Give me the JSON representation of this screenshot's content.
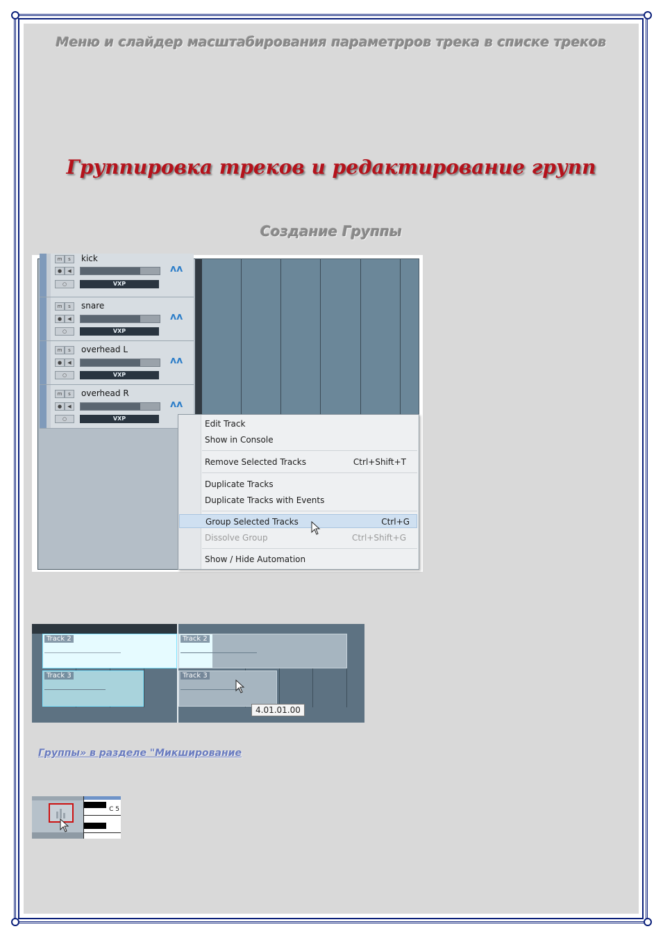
{
  "heading_top": "Меню и слайдер масштабирования параметрров трека в списке треков",
  "heading_main": "Группировка треков и редактирование групп",
  "heading_sub": "Создание Группы",
  "tracks": [
    {
      "name": "kick",
      "btn_m": "m",
      "btn_s": "s",
      "vxp": "VXP",
      "level": 0.75
    },
    {
      "name": "snare",
      "btn_m": "m",
      "btn_s": "s",
      "vxp": "VXP",
      "level": 0.75
    },
    {
      "name": "overhead L",
      "btn_m": "m",
      "btn_s": "s",
      "vxp": "VXP",
      "level": 0.75
    },
    {
      "name": "overhead R",
      "btn_m": "m",
      "btn_s": "s",
      "vxp": "VXP",
      "level": 0.75
    }
  ],
  "context_menu": {
    "items": [
      {
        "label": "Edit Track",
        "shortcut": ""
      },
      {
        "label": "Show in Console",
        "shortcut": ""
      },
      {
        "label": "Remove Selected Tracks",
        "shortcut": "Ctrl+Shift+T"
      },
      {
        "label": "Duplicate Tracks",
        "shortcut": ""
      },
      {
        "label": "Duplicate Tracks with Events",
        "shortcut": ""
      },
      {
        "label": "Group Selected Tracks",
        "shortcut": "Ctrl+G"
      },
      {
        "label": "Dissolve Group",
        "shortcut": "Ctrl+Shift+G"
      },
      {
        "label": "Show / Hide Automation",
        "shortcut": ""
      }
    ]
  },
  "clips": {
    "left_track2": "Track 2",
    "left_track3": "Track 3",
    "right_track2": "Track 2",
    "right_track3": "Track 3"
  },
  "tooltip": "4.01.01.00",
  "link_text": "Группы» в разделе \"Микширование",
  "piano_label": "C 5",
  "colors": {
    "frame": "#0a1f7a",
    "heading_red": "#b5121b",
    "highlight": "#cfe0f1",
    "clip_selected": "#e6fbff"
  }
}
